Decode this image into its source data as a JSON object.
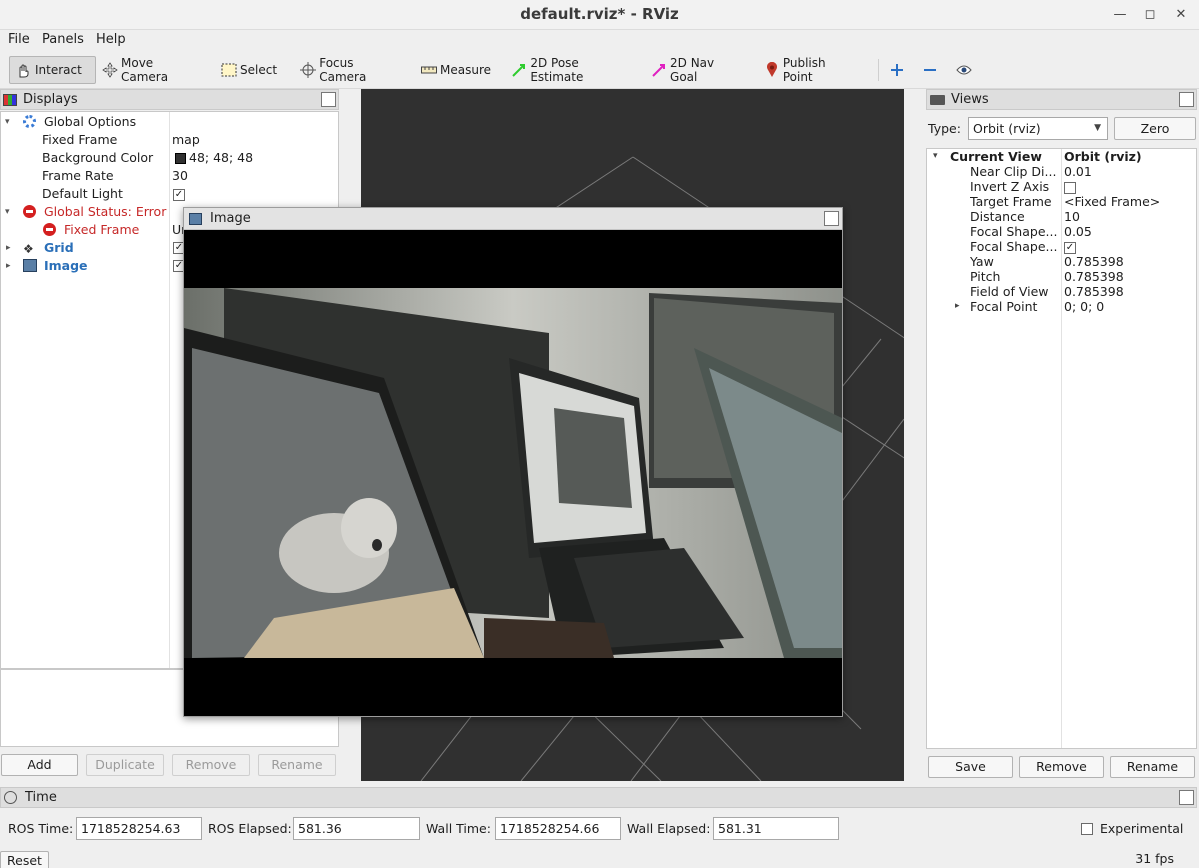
{
  "window": {
    "title": "default.rviz* - RViz"
  },
  "menu": [
    "File",
    "Panels",
    "Help"
  ],
  "toolbar": {
    "tools": [
      {
        "label": "Interact",
        "icon": "hand-icon",
        "active": true
      },
      {
        "label": "Move Camera",
        "icon": "move-camera-icon"
      },
      {
        "label": "Select",
        "icon": "select-box-icon"
      },
      {
        "label": "Focus Camera",
        "icon": "focus-camera-icon"
      },
      {
        "label": "Measure",
        "icon": "ruler-icon"
      },
      {
        "label": "2D Pose Estimate",
        "icon": "green-arrow-icon",
        "color": "#2ecc2e"
      },
      {
        "label": "2D Nav Goal",
        "icon": "magenta-arrow-icon",
        "color": "#e020c0"
      },
      {
        "label": "Publish Point",
        "icon": "map-pin-icon",
        "color": "#c0392b"
      }
    ],
    "extra_icons": [
      "plus-icon",
      "minus-icon",
      "eye-icon"
    ]
  },
  "displays": {
    "title": "Displays",
    "global_options": "Global Options",
    "fixed_frame": {
      "key": "Fixed Frame",
      "value": "map"
    },
    "background_color": {
      "key": "Background Color",
      "value": "48; 48; 48",
      "swatch": "#303030"
    },
    "frame_rate": {
      "key": "Frame Rate",
      "value": "30"
    },
    "default_light": {
      "key": "Default Light",
      "checked": true
    },
    "global_status": "Global Status: Error",
    "fixed_frame_error": "Fixed Frame",
    "fixed_frame_error_value": "Ur",
    "grid": "Grid",
    "image": "Image",
    "buttons": {
      "add": "Add",
      "duplicate": "Duplicate",
      "remove": "Remove",
      "rename": "Rename"
    }
  },
  "image_window": {
    "title": "Image"
  },
  "views": {
    "title": "Views",
    "type_label": "Type:",
    "type_value": "Orbit (rviz)",
    "zero": "Zero",
    "current_view": {
      "key": "Current View",
      "value": "Orbit (rviz)"
    },
    "props": [
      {
        "key": "Near Clip Di...",
        "value": "0.01"
      },
      {
        "key": "Invert Z Axis",
        "value": "",
        "checkbox": false
      },
      {
        "key": "Target Frame",
        "value": "<Fixed Frame>"
      },
      {
        "key": "Distance",
        "value": "10"
      },
      {
        "key": "Focal Shape...",
        "value": "0.05"
      },
      {
        "key": "Focal Shape...",
        "value": "",
        "checkbox": true
      },
      {
        "key": "Yaw",
        "value": "0.785398"
      },
      {
        "key": "Pitch",
        "value": "0.785398"
      },
      {
        "key": "Field of View",
        "value": "0.785398"
      },
      {
        "key": "Focal Point",
        "value": "0; 0; 0"
      }
    ],
    "buttons": {
      "save": "Save",
      "remove": "Remove",
      "rename": "Rename"
    }
  },
  "time": {
    "title": "Time",
    "ros_time_label": "ROS Time:",
    "ros_time": "1718528254.63",
    "ros_elapsed_label": "ROS Elapsed:",
    "ros_elapsed": "581.36",
    "wall_time_label": "Wall Time:",
    "wall_time": "1718528254.66",
    "wall_elapsed_label": "Wall Elapsed:",
    "wall_elapsed": "581.31",
    "experimental": "Experimental",
    "reset": "Reset",
    "fps": "31 fps"
  }
}
